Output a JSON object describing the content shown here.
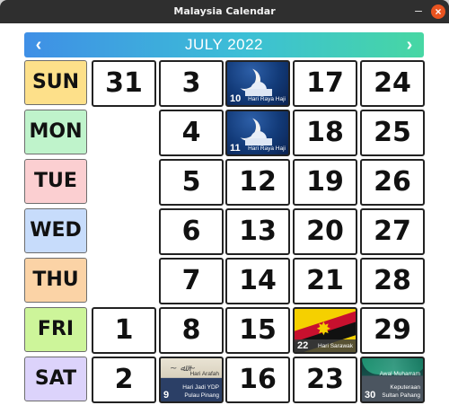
{
  "window": {
    "title": "Malaysia Calendar",
    "minimize_glyph": "–",
    "close_glyph": "×"
  },
  "header": {
    "month_label": "JULY 2022",
    "prev_glyph": "‹",
    "next_glyph": "›"
  },
  "days": [
    "SUN",
    "MON",
    "TUE",
    "WED",
    "THU",
    "FRI",
    "SAT"
  ],
  "day_colors": [
    "#fde08a",
    "#bff3cb",
    "#fbcfd1",
    "#c7dcfb",
    "#fbd3a6",
    "#cdf59a",
    "#dcd3fb"
  ],
  "cells": {
    "c_sun_0": "31",
    "c_sun_1": "3",
    "c_sun_3": "17",
    "c_sun_4": "24",
    "c_mon_1": "4",
    "c_mon_3": "18",
    "c_mon_4": "25",
    "c_tue_1": "5",
    "c_tue_2": "12",
    "c_tue_3": "19",
    "c_tue_4": "26",
    "c_wed_1": "6",
    "c_wed_2": "13",
    "c_wed_3": "20",
    "c_wed_4": "27",
    "c_thu_1": "7",
    "c_thu_2": "14",
    "c_thu_3": "21",
    "c_thu_4": "28",
    "c_fri_0": "1",
    "c_fri_1": "8",
    "c_fri_2": "15",
    "c_fri_4": "29",
    "c_sat_0": "2",
    "c_sat_2": "16",
    "c_sat_3": "23"
  },
  "holidays": {
    "jul10": {
      "day": "10",
      "label": "Hari Raya Haji"
    },
    "jul11": {
      "day": "11",
      "label": "Hari Raya Haji"
    },
    "jul22": {
      "day": "22",
      "label": "Hari Sarawak"
    },
    "jul9": {
      "day": "9",
      "label1": "Hari Arafah",
      "label2": "Hari Jadi YDP",
      "label3": "Pulau Pinang"
    },
    "jul30": {
      "day": "30",
      "label1": "Awal Muharram",
      "label2": "Keputeraan",
      "label3": "Sultan Pahang"
    }
  }
}
